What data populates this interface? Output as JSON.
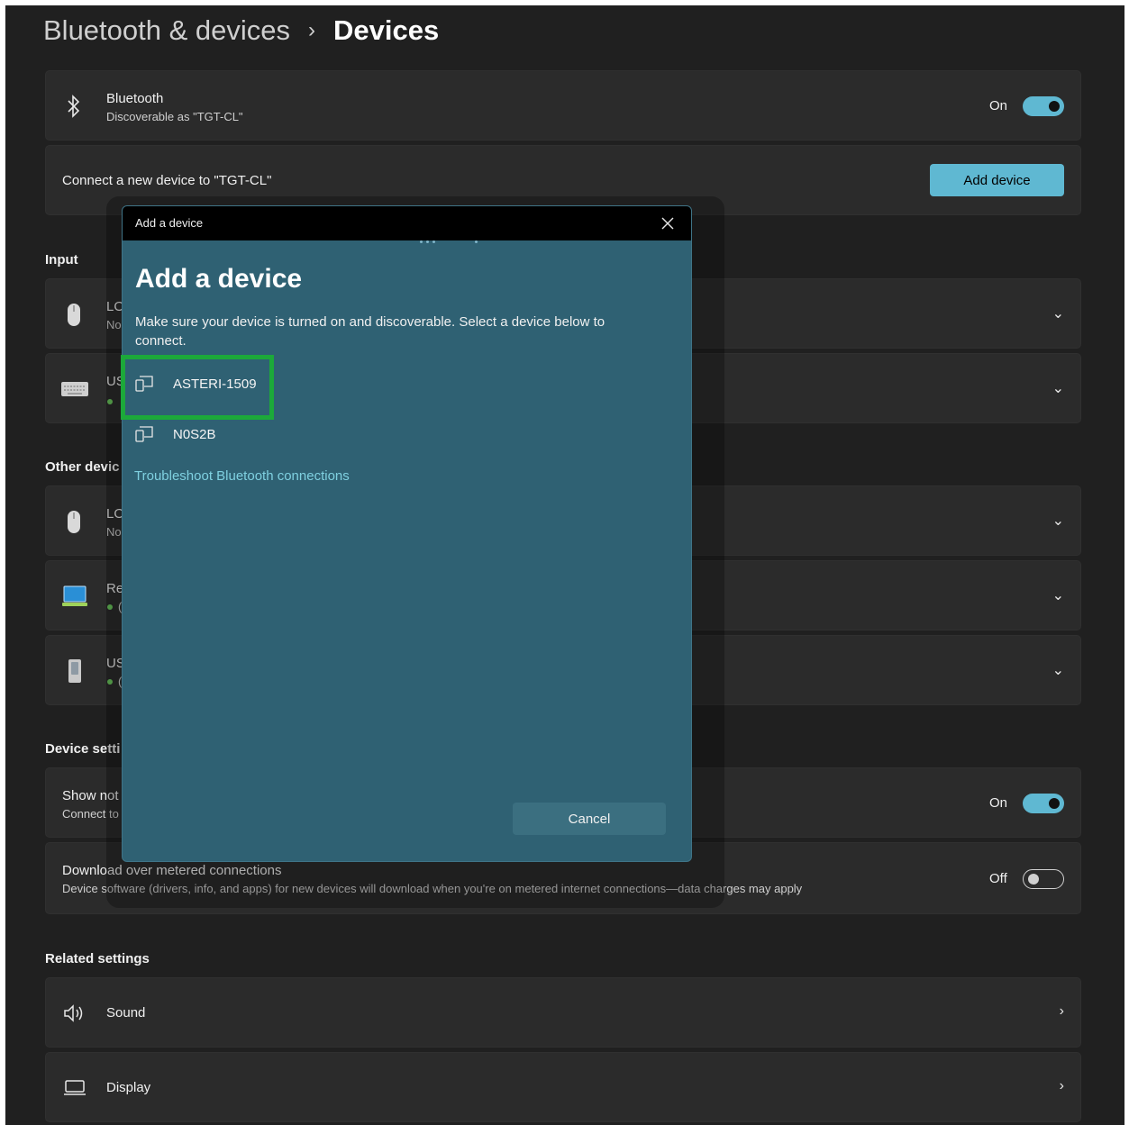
{
  "breadcrumb": {
    "parent": "Bluetooth & devices",
    "separator": "›",
    "current": "Devices"
  },
  "bluetooth": {
    "title": "Bluetooth",
    "subtitle": "Discoverable as \"TGT-CL\"",
    "toggle_label": "On"
  },
  "connect": {
    "text": "Connect a new device to \"TGT-CL\"",
    "button": "Add device"
  },
  "sections": {
    "input": "Input",
    "other": "Other devic",
    "device_settings": "Device setti",
    "related": "Related settings"
  },
  "input_devices": [
    {
      "name": "LO",
      "status": "No",
      "icon": "mouse-icon"
    },
    {
      "name": "US",
      "status": "",
      "icon": "keyboard-icon"
    }
  ],
  "other_devices": [
    {
      "name": "LO",
      "status": "No",
      "icon": "mouse-icon"
    },
    {
      "name": "Re",
      "status": "(",
      "icon": "laptop-icon"
    },
    {
      "name": "US",
      "status": "(",
      "icon": "usb-drive-icon"
    }
  ],
  "device_settings": {
    "notifications": {
      "title": "Show not",
      "subtitle": "Connect to",
      "toggle_label": "On"
    },
    "metered": {
      "title": "Download over metered connections",
      "subtitle": "Device software (drivers, info, and apps) for new devices will download when you're on metered internet connections—data charges may apply",
      "toggle_label": "Off"
    }
  },
  "related": [
    {
      "label": "Sound",
      "icon": "speaker-icon"
    },
    {
      "label": "Display",
      "icon": "monitor-icon"
    }
  ],
  "dialog": {
    "window_title": "Add a device",
    "heading": "Add a device",
    "instructions": "Make sure your device is turned on and discoverable. Select a device below to connect.",
    "devices": [
      "ASTERI-1509",
      "N0S2B"
    ],
    "troubleshoot_link": "Troubleshoot Bluetooth connections",
    "cancel": "Cancel"
  },
  "colors": {
    "accent": "#5fb8d2",
    "dialog_bg": "#2f6173",
    "highlight": "#1ca93a",
    "link": "#7fd0e0"
  }
}
